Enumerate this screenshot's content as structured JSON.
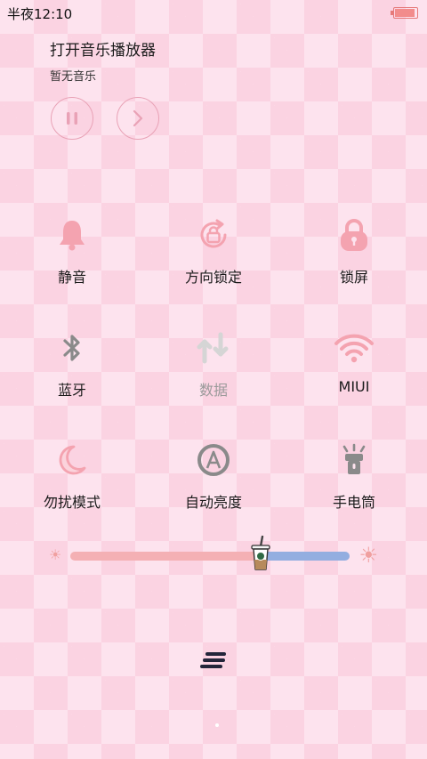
{
  "status": {
    "time": "半夜12:10",
    "battery_level": 0.9
  },
  "music": {
    "title": "打开音乐播放器",
    "subtitle": "暂无音乐"
  },
  "toggles": [
    {
      "label": "静音",
      "icon": "bell-icon"
    },
    {
      "label": "方向锁定",
      "icon": "rotation-lock-icon"
    },
    {
      "label": "锁屏",
      "icon": "lock-icon"
    },
    {
      "label": "蓝牙",
      "icon": "bluetooth-icon"
    },
    {
      "label": "数据",
      "icon": "data-icon",
      "disabled": true
    },
    {
      "label": "MIUI",
      "icon": "wifi-icon"
    },
    {
      "label": "勿扰模式",
      "icon": "moon-icon"
    },
    {
      "label": "自动亮度",
      "icon": "auto-brightness-icon"
    },
    {
      "label": "手电筒",
      "icon": "flashlight-icon"
    }
  ],
  "brightness": {
    "level": 0.68
  },
  "colors": {
    "accent_pink": "#f4a3b0",
    "slider_blue": "#93aee0",
    "background": "#fde3ee"
  }
}
